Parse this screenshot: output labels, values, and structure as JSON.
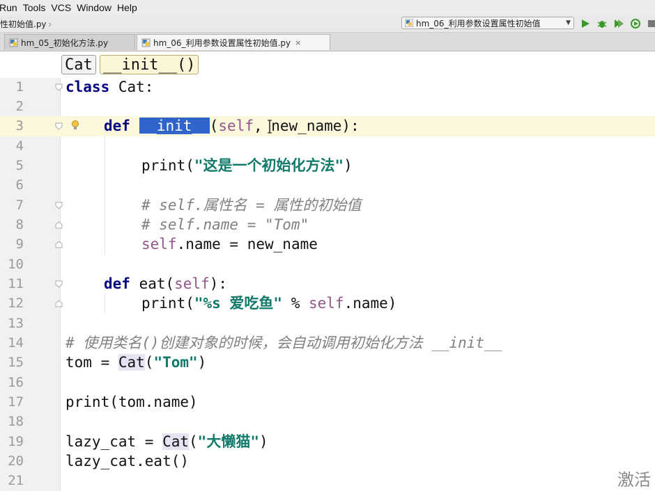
{
  "menu": {
    "items": [
      "Run",
      "Tools",
      "VCS",
      "Window",
      "Help"
    ]
  },
  "navbar": {
    "breadcrumb": "性初始值.py",
    "run_config": "hm_06_利用参数设置属性初始值"
  },
  "tabs": [
    {
      "label": "hm_05_初始化方法.py",
      "active": false
    },
    {
      "label": "hm_06_利用参数设置属性初始值.py",
      "active": true
    }
  ],
  "structure": {
    "class_name": "Cat",
    "method_name": "__init__()"
  },
  "code": {
    "line_numbers": [
      "1",
      "2",
      "3",
      "4",
      "5",
      "6",
      "7",
      "8",
      "9",
      "10",
      "11",
      "12",
      "13",
      "14",
      "15",
      "16",
      "17",
      "18",
      "19",
      "20",
      "21"
    ],
    "l1_kw": "class",
    "l1_rest": " Cat:",
    "l3_kw": "def",
    "l3_fn": "__init__",
    "l3_p1": "(",
    "l3_self": "self",
    "l3_rest": ", new_name):",
    "l5_a": "print(",
    "l5_str": "\"这是一个初始化方法\"",
    "l5_b": ")",
    "l7": "# self.属性名 = 属性的初始值",
    "l8": "# self.name = \"Tom\"",
    "l9_self": "self",
    "l9_rest": ".name = new_name",
    "l11_kw": "def",
    "l11_a": " eat(",
    "l11_self": "self",
    "l11_b": "):",
    "l12_a": "print(",
    "l12_str": "\"%s 爱吃鱼\"",
    "l12_b": " % ",
    "l12_self": "self",
    "l12_c": ".name)",
    "l14": "# 使用类名()创建对象的时候，会自动调用初始化方法 __init__",
    "l15_a": "tom = ",
    "l15_cls": "Cat",
    "l15_b": "(",
    "l15_str": "\"Tom\"",
    "l15_c": ")",
    "l17": "print(tom.name)",
    "l19_a": "lazy_cat = ",
    "l19_cls": "Cat",
    "l19_b": "(",
    "l19_str": "\"大懒猫\"",
    "l19_c": ")",
    "l20": "lazy_cat.eat()"
  },
  "watermark": "激活",
  "colors": {
    "keyword": "#000080",
    "self": "#94558d",
    "string": "#117a6b",
    "comment": "#808080",
    "selection": "#2f65ca",
    "current_line": "#fcf8dc"
  }
}
